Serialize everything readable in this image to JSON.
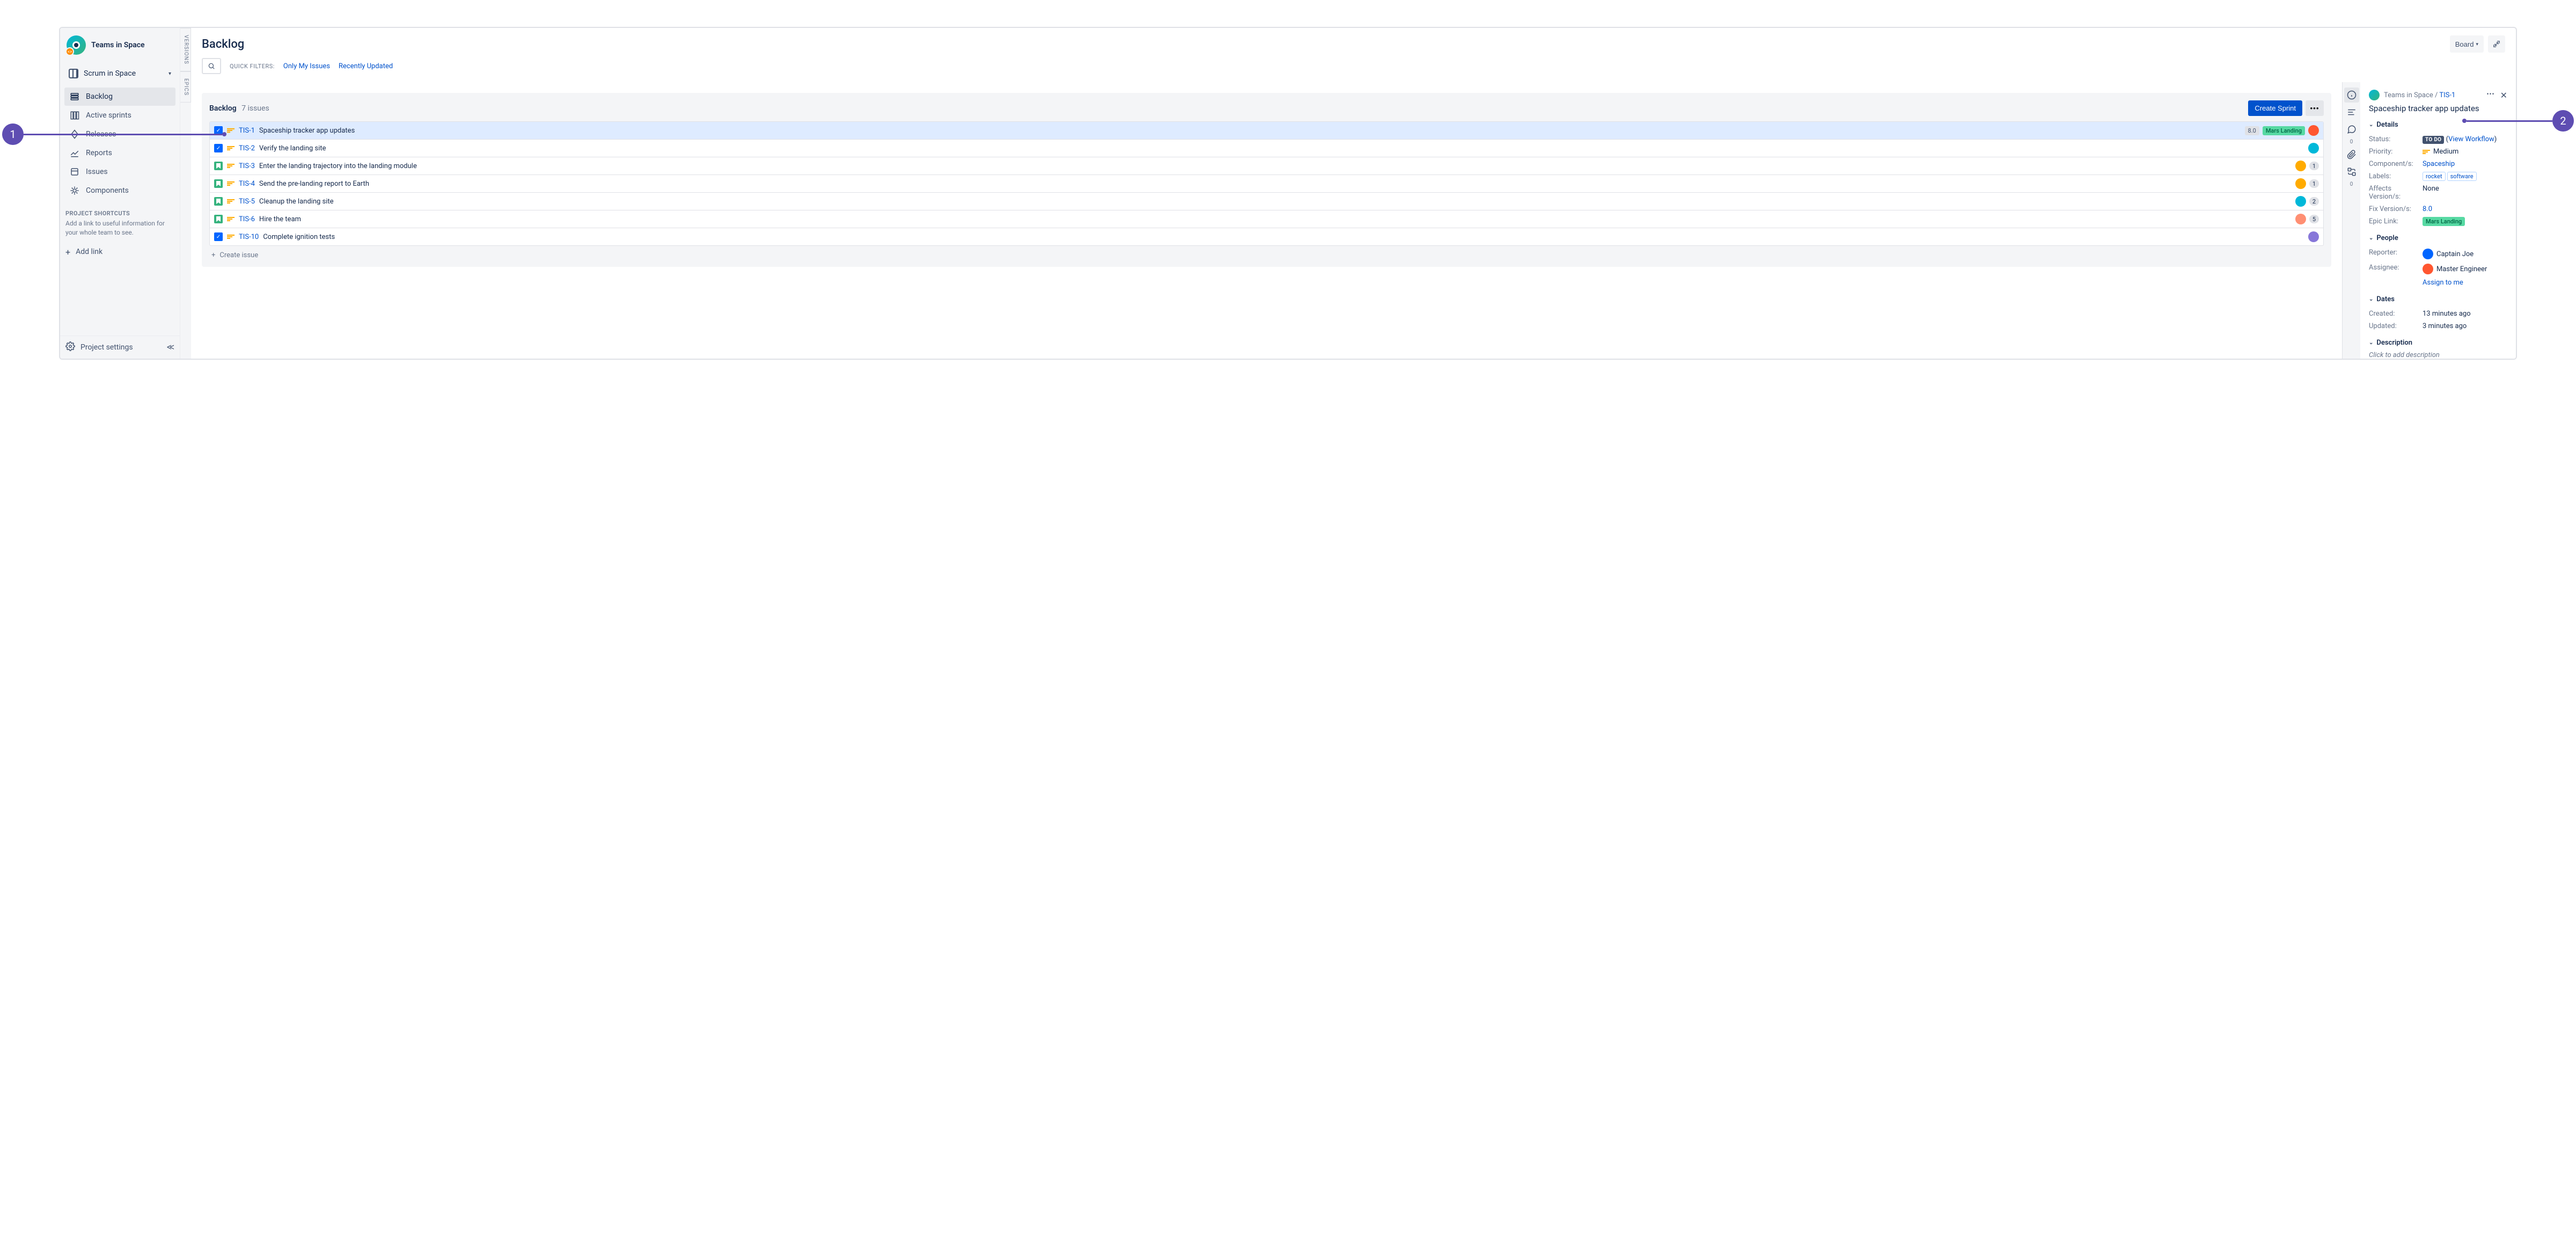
{
  "annotations": {
    "left": "1",
    "right": "2"
  },
  "sidebar": {
    "project_name": "Teams in Space",
    "board_name": "Scrum in Space",
    "nav": [
      {
        "label": "Backlog"
      },
      {
        "label": "Active sprints"
      },
      {
        "label": "Releases"
      },
      {
        "label": "Reports"
      },
      {
        "label": "Issues"
      },
      {
        "label": "Components"
      }
    ],
    "shortcuts_header": "PROJECT SHORTCUTS",
    "shortcuts_desc": "Add a link to useful information for your whole team to see.",
    "add_link": "Add link",
    "settings": "Project settings"
  },
  "side_tabs": {
    "versions": "VERSIONS",
    "epics": "EPICS"
  },
  "header": {
    "title": "Backlog",
    "board_button": "Board",
    "filters_label": "QUICK FILTERS:",
    "filters": [
      "Only My Issues",
      "Recently Updated"
    ]
  },
  "backlog": {
    "title": "Backlog",
    "count": "7 issues",
    "create_sprint": "Create Sprint",
    "create_issue": "Create issue",
    "issues": [
      {
        "type": "task",
        "key": "TIS-1",
        "summary": "Spaceship tracker app updates",
        "version": "8.0",
        "epic": "Mars Landing",
        "avatar": "#FF5630",
        "selected": true
      },
      {
        "type": "task",
        "key": "TIS-2",
        "summary": "Verify the landing site",
        "avatar": "#00B8D9"
      },
      {
        "type": "story",
        "key": "TIS-3",
        "summary": "Enter the landing trajectory into the landing module",
        "avatar": "#FFAB00",
        "count": "1"
      },
      {
        "type": "story",
        "key": "TIS-4",
        "summary": "Send the pre-landing report to Earth",
        "avatar": "#FFAB00",
        "count": "1"
      },
      {
        "type": "story",
        "key": "TIS-5",
        "summary": "Cleanup the landing site",
        "avatar": "#00B8D9",
        "count": "2"
      },
      {
        "type": "story",
        "key": "TIS-6",
        "summary": "Hire the team",
        "avatar": "#FF8F73",
        "count": "5"
      },
      {
        "type": "task",
        "key": "TIS-10",
        "summary": "Complete ignition tests",
        "avatar": "#8777D9"
      }
    ]
  },
  "strip": {
    "comments_count": "0",
    "subtasks_count": "0"
  },
  "details": {
    "crumb_project": "Teams in Space",
    "crumb_sep": " / ",
    "crumb_key": "TIS-1",
    "title": "Spaceship tracker app updates",
    "sections": {
      "details": "Details",
      "people": "People",
      "dates": "Dates",
      "description": "Description"
    },
    "fields": {
      "status_label": "Status:",
      "status_value": "TO DO",
      "workflow": "View Workflow",
      "priority_label": "Priority:",
      "priority_value": "Medium",
      "components_label": "Component/s:",
      "components_value": "Spaceship",
      "labels_label": "Labels:",
      "labels": [
        "rocket",
        "software"
      ],
      "affects_label": "Affects Version/s:",
      "affects_value": "None",
      "fix_label": "Fix Version/s:",
      "fix_value": "8.0",
      "epic_label": "Epic Link:",
      "epic_value": "Mars Landing",
      "reporter_label": "Reporter:",
      "reporter_value": "Captain Joe",
      "assignee_label": "Assignee:",
      "assignee_value": "Master Engineer",
      "assign_to_me": "Assign to me",
      "created_label": "Created:",
      "created_value": "13 minutes ago",
      "updated_label": "Updated:",
      "updated_value": "3 minutes ago",
      "description_placeholder": "Click to add description"
    }
  }
}
